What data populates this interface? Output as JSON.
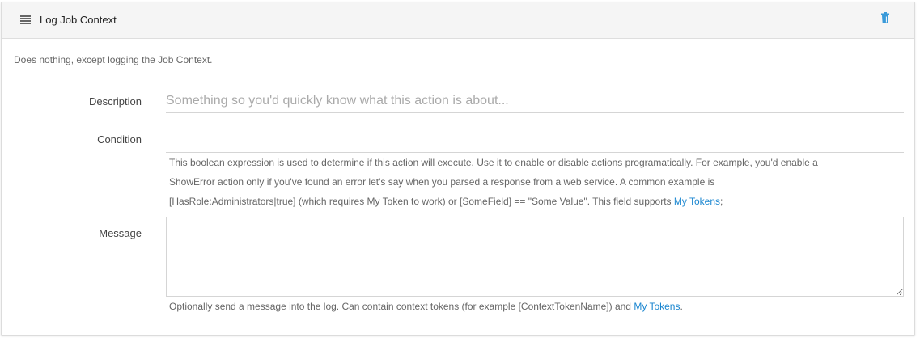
{
  "header": {
    "title": "Log Job Context",
    "handle_icon": "drag-handle-icon",
    "delete_icon": "trash-icon"
  },
  "intro": "Does nothing, except logging the Job Context.",
  "fields": {
    "description": {
      "label": "Description",
      "value": "",
      "placeholder": "Something so you'd quickly know what this action is about..."
    },
    "condition": {
      "label": "Condition",
      "value": "",
      "help_line1": "This boolean expression is used to determine if this action will execute. Use it to enable or disable actions programatically. For example, you'd enable a",
      "help_line2": "ShowError action only if you've found an error let's say when you parsed a response from a web service. A common example is",
      "help_line3": "[HasRole:Administrators|true] (which requires My Token to work) or [SomeField] == \"Some Value\". This field supports ",
      "help_link": "My Tokens",
      "help_suffix": ";"
    },
    "message": {
      "label": "Message",
      "value": "",
      "help_text": "Optionally send a message into the log. Can contain context tokens (for example [ContextTokenName]) and ",
      "help_link": "My Tokens",
      "help_suffix": "."
    }
  },
  "colors": {
    "link": "#1a86d0",
    "header_bg": "#f5f5f5",
    "trash_icon": "#3a9ad9"
  }
}
